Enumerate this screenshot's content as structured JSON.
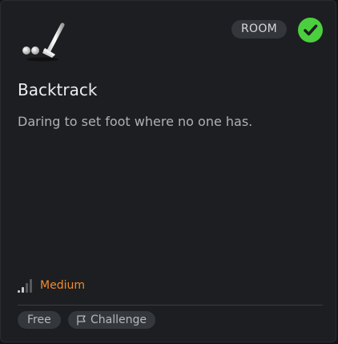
{
  "room": {
    "type_badge": "ROOM",
    "completed": true,
    "title": "Backtrack",
    "description": "Daring to set foot where no one has.",
    "difficulty": {
      "label": "Medium",
      "level": 2,
      "max_level": 4,
      "color": "#f28b2c"
    },
    "tags": [
      {
        "label": "Free",
        "icon": ""
      },
      {
        "label": "Challenge",
        "icon": "flag-icon"
      }
    ]
  },
  "colors": {
    "card_background": "#1c1e21",
    "check_green": "#4ccf3e",
    "badge_background": "#33363b",
    "tag_background": "#34373c"
  },
  "icons": {
    "room_logo": "golf-club-ball-icon",
    "completed": "checkmark-circle-icon",
    "difficulty": "signal-bars-icon"
  }
}
